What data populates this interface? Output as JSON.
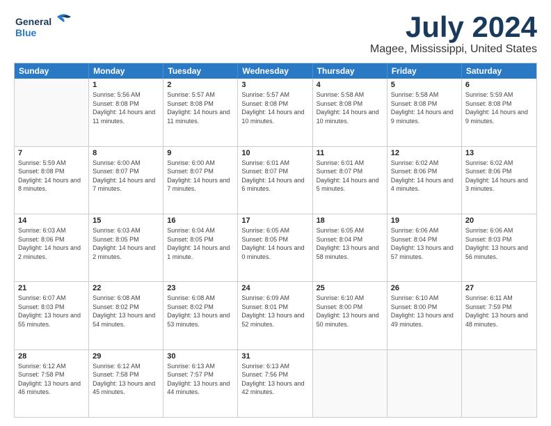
{
  "header": {
    "logo_line1": "General",
    "logo_line2": "Blue",
    "month_title": "July 2024",
    "location": "Magee, Mississippi, United States"
  },
  "calendar": {
    "days_of_week": [
      "Sunday",
      "Monday",
      "Tuesday",
      "Wednesday",
      "Thursday",
      "Friday",
      "Saturday"
    ],
    "rows": [
      [
        {
          "day": "",
          "empty": true,
          "sunrise": "",
          "sunset": "",
          "daylight": ""
        },
        {
          "day": "1",
          "empty": false,
          "sunrise": "Sunrise: 5:56 AM",
          "sunset": "Sunset: 8:08 PM",
          "daylight": "Daylight: 14 hours and 11 minutes."
        },
        {
          "day": "2",
          "empty": false,
          "sunrise": "Sunrise: 5:57 AM",
          "sunset": "Sunset: 8:08 PM",
          "daylight": "Daylight: 14 hours and 11 minutes."
        },
        {
          "day": "3",
          "empty": false,
          "sunrise": "Sunrise: 5:57 AM",
          "sunset": "Sunset: 8:08 PM",
          "daylight": "Daylight: 14 hours and 10 minutes."
        },
        {
          "day": "4",
          "empty": false,
          "sunrise": "Sunrise: 5:58 AM",
          "sunset": "Sunset: 8:08 PM",
          "daylight": "Daylight: 14 hours and 10 minutes."
        },
        {
          "day": "5",
          "empty": false,
          "sunrise": "Sunrise: 5:58 AM",
          "sunset": "Sunset: 8:08 PM",
          "daylight": "Daylight: 14 hours and 9 minutes."
        },
        {
          "day": "6",
          "empty": false,
          "sunrise": "Sunrise: 5:59 AM",
          "sunset": "Sunset: 8:08 PM",
          "daylight": "Daylight: 14 hours and 9 minutes."
        }
      ],
      [
        {
          "day": "7",
          "empty": false,
          "sunrise": "Sunrise: 5:59 AM",
          "sunset": "Sunset: 8:08 PM",
          "daylight": "Daylight: 14 hours and 8 minutes."
        },
        {
          "day": "8",
          "empty": false,
          "sunrise": "Sunrise: 6:00 AM",
          "sunset": "Sunset: 8:07 PM",
          "daylight": "Daylight: 14 hours and 7 minutes."
        },
        {
          "day": "9",
          "empty": false,
          "sunrise": "Sunrise: 6:00 AM",
          "sunset": "Sunset: 8:07 PM",
          "daylight": "Daylight: 14 hours and 7 minutes."
        },
        {
          "day": "10",
          "empty": false,
          "sunrise": "Sunrise: 6:01 AM",
          "sunset": "Sunset: 8:07 PM",
          "daylight": "Daylight: 14 hours and 6 minutes."
        },
        {
          "day": "11",
          "empty": false,
          "sunrise": "Sunrise: 6:01 AM",
          "sunset": "Sunset: 8:07 PM",
          "daylight": "Daylight: 14 hours and 5 minutes."
        },
        {
          "day": "12",
          "empty": false,
          "sunrise": "Sunrise: 6:02 AM",
          "sunset": "Sunset: 8:06 PM",
          "daylight": "Daylight: 14 hours and 4 minutes."
        },
        {
          "day": "13",
          "empty": false,
          "sunrise": "Sunrise: 6:02 AM",
          "sunset": "Sunset: 8:06 PM",
          "daylight": "Daylight: 14 hours and 3 minutes."
        }
      ],
      [
        {
          "day": "14",
          "empty": false,
          "sunrise": "Sunrise: 6:03 AM",
          "sunset": "Sunset: 8:06 PM",
          "daylight": "Daylight: 14 hours and 2 minutes."
        },
        {
          "day": "15",
          "empty": false,
          "sunrise": "Sunrise: 6:03 AM",
          "sunset": "Sunset: 8:05 PM",
          "daylight": "Daylight: 14 hours and 2 minutes."
        },
        {
          "day": "16",
          "empty": false,
          "sunrise": "Sunrise: 6:04 AM",
          "sunset": "Sunset: 8:05 PM",
          "daylight": "Daylight: 14 hours and 1 minute."
        },
        {
          "day": "17",
          "empty": false,
          "sunrise": "Sunrise: 6:05 AM",
          "sunset": "Sunset: 8:05 PM",
          "daylight": "Daylight: 14 hours and 0 minutes."
        },
        {
          "day": "18",
          "empty": false,
          "sunrise": "Sunrise: 6:05 AM",
          "sunset": "Sunset: 8:04 PM",
          "daylight": "Daylight: 13 hours and 58 minutes."
        },
        {
          "day": "19",
          "empty": false,
          "sunrise": "Sunrise: 6:06 AM",
          "sunset": "Sunset: 8:04 PM",
          "daylight": "Daylight: 13 hours and 57 minutes."
        },
        {
          "day": "20",
          "empty": false,
          "sunrise": "Sunrise: 6:06 AM",
          "sunset": "Sunset: 8:03 PM",
          "daylight": "Daylight: 13 hours and 56 minutes."
        }
      ],
      [
        {
          "day": "21",
          "empty": false,
          "sunrise": "Sunrise: 6:07 AM",
          "sunset": "Sunset: 8:03 PM",
          "daylight": "Daylight: 13 hours and 55 minutes."
        },
        {
          "day": "22",
          "empty": false,
          "sunrise": "Sunrise: 6:08 AM",
          "sunset": "Sunset: 8:02 PM",
          "daylight": "Daylight: 13 hours and 54 minutes."
        },
        {
          "day": "23",
          "empty": false,
          "sunrise": "Sunrise: 6:08 AM",
          "sunset": "Sunset: 8:02 PM",
          "daylight": "Daylight: 13 hours and 53 minutes."
        },
        {
          "day": "24",
          "empty": false,
          "sunrise": "Sunrise: 6:09 AM",
          "sunset": "Sunset: 8:01 PM",
          "daylight": "Daylight: 13 hours and 52 minutes."
        },
        {
          "day": "25",
          "empty": false,
          "sunrise": "Sunrise: 6:10 AM",
          "sunset": "Sunset: 8:00 PM",
          "daylight": "Daylight: 13 hours and 50 minutes."
        },
        {
          "day": "26",
          "empty": false,
          "sunrise": "Sunrise: 6:10 AM",
          "sunset": "Sunset: 8:00 PM",
          "daylight": "Daylight: 13 hours and 49 minutes."
        },
        {
          "day": "27",
          "empty": false,
          "sunrise": "Sunrise: 6:11 AM",
          "sunset": "Sunset: 7:59 PM",
          "daylight": "Daylight: 13 hours and 48 minutes."
        }
      ],
      [
        {
          "day": "28",
          "empty": false,
          "sunrise": "Sunrise: 6:12 AM",
          "sunset": "Sunset: 7:58 PM",
          "daylight": "Daylight: 13 hours and 46 minutes."
        },
        {
          "day": "29",
          "empty": false,
          "sunrise": "Sunrise: 6:12 AM",
          "sunset": "Sunset: 7:58 PM",
          "daylight": "Daylight: 13 hours and 45 minutes."
        },
        {
          "day": "30",
          "empty": false,
          "sunrise": "Sunrise: 6:13 AM",
          "sunset": "Sunset: 7:57 PM",
          "daylight": "Daylight: 13 hours and 44 minutes."
        },
        {
          "day": "31",
          "empty": false,
          "sunrise": "Sunrise: 6:13 AM",
          "sunset": "Sunset: 7:56 PM",
          "daylight": "Daylight: 13 hours and 42 minutes."
        },
        {
          "day": "",
          "empty": true,
          "sunrise": "",
          "sunset": "",
          "daylight": ""
        },
        {
          "day": "",
          "empty": true,
          "sunrise": "",
          "sunset": "",
          "daylight": ""
        },
        {
          "day": "",
          "empty": true,
          "sunrise": "",
          "sunset": "",
          "daylight": ""
        }
      ]
    ]
  }
}
